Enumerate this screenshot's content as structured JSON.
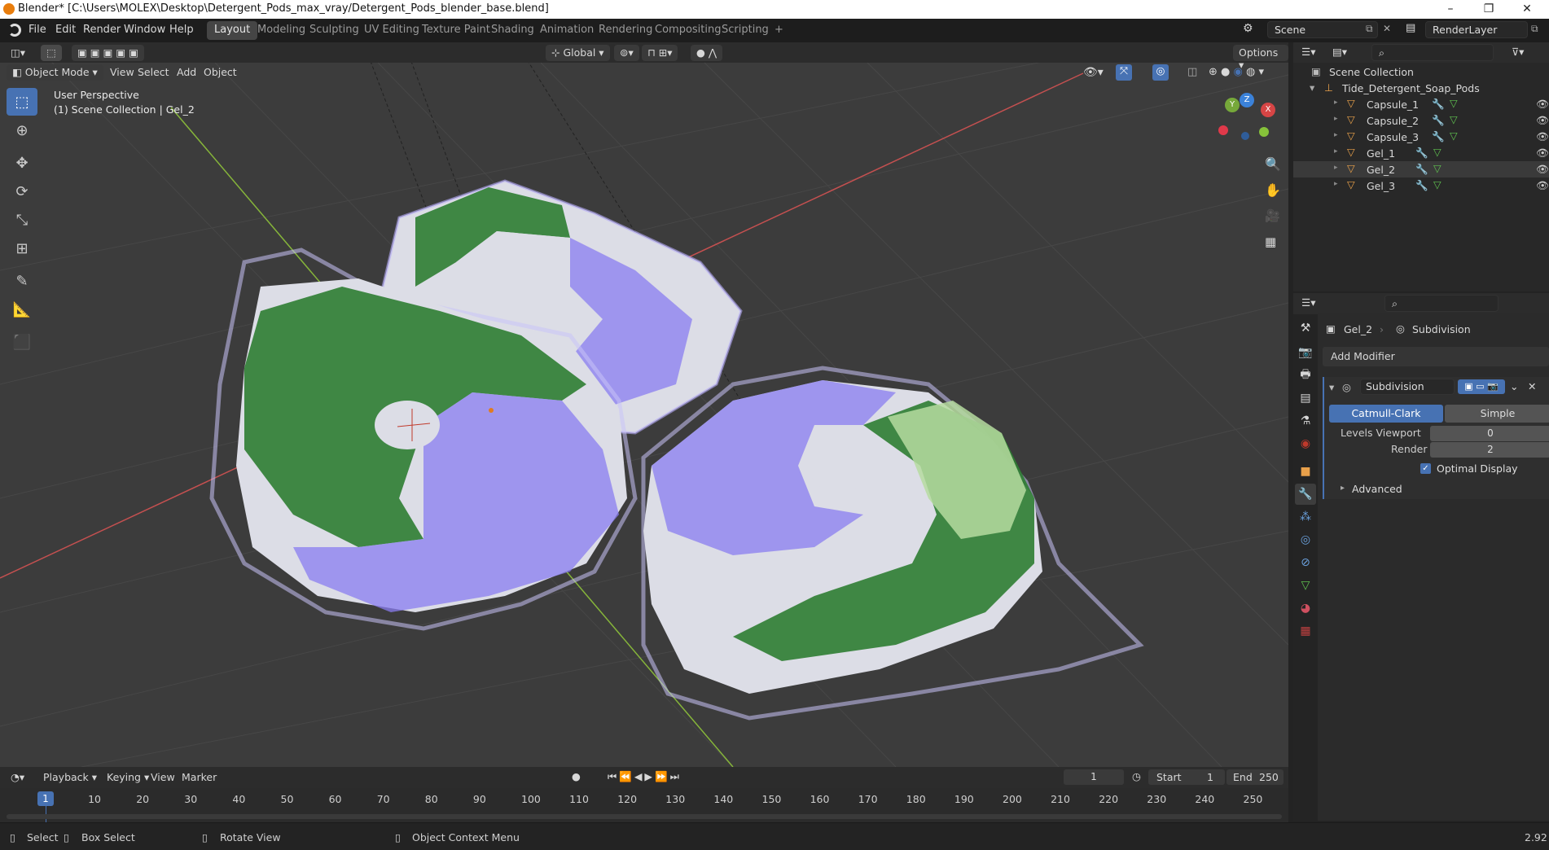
{
  "window": {
    "title": "Blender* [C:\\Users\\MOLEX\\Desktop\\Detergent_Pods_max_vray/Detergent_Pods_blender_base.blend]",
    "minimize": "–",
    "maximize": "❐",
    "close": "✕"
  },
  "menubar": {
    "items": [
      "File",
      "Edit",
      "Render",
      "Window",
      "Help"
    ]
  },
  "workspaces": {
    "tabs": [
      "Layout",
      "Modeling",
      "Sculpting",
      "UV Editing",
      "Texture Paint",
      "Shading",
      "Animation",
      "Rendering",
      "Compositing",
      "Scripting"
    ],
    "active": "Layout",
    "add": "+"
  },
  "scene": {
    "name": "Scene",
    "view_layer": "RenderLayer"
  },
  "viewport_header": {
    "mode": "Object Mode",
    "menus": [
      "View",
      "Select",
      "Add",
      "Object"
    ],
    "transform_orientation": "Global",
    "options": "Options"
  },
  "viewport": {
    "perspective": "User Perspective",
    "collection_info": "(1) Scene Collection | Gel_2",
    "gizmo": {
      "x": "X",
      "y": "Y",
      "z": "Z"
    }
  },
  "outliner": {
    "root": "Scene Collection",
    "collection": "Tide_Detergent_Soap_Pods",
    "objects": [
      "Capsule_1",
      "Capsule_2",
      "Capsule_3",
      "Gel_1",
      "Gel_2",
      "Gel_3"
    ],
    "selected": "Gel_2"
  },
  "properties": {
    "object": "Gel_2",
    "modifier_breadcrumb": "Subdivision",
    "add_modifier": "Add Modifier",
    "modifier": {
      "name": "Subdivision",
      "types": [
        "Catmull-Clark",
        "Simple"
      ],
      "active_type": "Catmull-Clark",
      "levels_viewport_label": "Levels Viewport",
      "levels_viewport": "0",
      "render_label": "Render",
      "render": "2",
      "optimal_display_label": "Optimal Display",
      "optimal_display": true,
      "advanced": "Advanced"
    }
  },
  "timeline": {
    "menus": [
      "Playback",
      "Keying",
      "View",
      "Marker"
    ],
    "current_frame": "1",
    "start_label": "Start",
    "start": "1",
    "end_label": "End",
    "end": "250",
    "ticks": [
      "10",
      "20",
      "30",
      "40",
      "50",
      "60",
      "70",
      "80",
      "90",
      "100",
      "110",
      "120",
      "130",
      "140",
      "150",
      "160",
      "170",
      "180",
      "190",
      "200",
      "210",
      "220",
      "230",
      "240",
      "250"
    ],
    "playhead": "1"
  },
  "statusbar": {
    "select": "Select",
    "box_select": "Box Select",
    "rotate_view": "Rotate View",
    "context_menu": "Object Context Menu",
    "version": "2.92"
  },
  "colors": {
    "accent": "#4772b3",
    "viewport_bg": "#3c3c3c",
    "gel_green": "#2e7d32",
    "gel_purple": "#8a7cf0",
    "pod_white": "#dcdde6",
    "axis_x": "#d64545",
    "axis_y": "#86b53a"
  }
}
